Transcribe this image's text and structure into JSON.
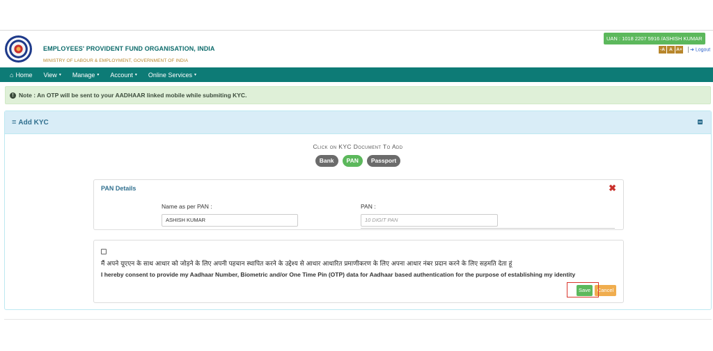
{
  "header": {
    "org_name": "EMPLOYEES' PROVIDENT FUND ORGANISATION, INDIA",
    "ministry": "MINISTRY OF LABOUR & EMPLOYMENT, GOVERNMENT OF INDIA",
    "uan": "UAN : 1018 2207 5916 /ASHISH KUMAR",
    "font_buttons": [
      "-A",
      "A",
      "A+"
    ],
    "logout": "Logout"
  },
  "nav": {
    "items": [
      {
        "label": "Home",
        "icon": "home-icon"
      },
      {
        "label": "View",
        "caret": true
      },
      {
        "label": "Manage",
        "caret": true
      },
      {
        "label": "Account",
        "caret": true
      },
      {
        "label": "Online Services",
        "caret": true
      }
    ]
  },
  "note": {
    "text": "Note : An OTP will be sent to your AADHAAR linked mobile while submiting KYC."
  },
  "panel": {
    "title": "Add KYC",
    "instruction": "Click on KYC Document To Add",
    "doc_buttons": [
      {
        "label": "Bank",
        "active": false
      },
      {
        "label": "PAN",
        "active": true
      },
      {
        "label": "Passport",
        "active": false
      }
    ]
  },
  "pan": {
    "title": "PAN Details",
    "name_label": "Name as per PAN  :",
    "name_value": "ASHISH KUMAR",
    "pan_label": "PAN  :",
    "pan_placeholder": "10 DIGIT PAN"
  },
  "consent": {
    "hindi": "मैं अपने यूएएन के साथ आधार को जोड़ने के लिए अपनी पहचान स्थापित करने के उद्देश्य से आधार आधारित प्रमाणीकरण के लिए अपना आधार नंबर प्रदान करने के लिए सहमति देता हूं",
    "english": "I hereby consent to provide my Aadhaar Number, Biometric and/or One Time Pin (OTP) data for Aadhaar based authentication for the purpose of establishing my identity",
    "save": "Save",
    "cancel": "Cancel"
  },
  "colors": {
    "nav_bg": "#0d7b76",
    "success": "#5cb85c",
    "warning": "#f0ad4e",
    "panel_heading": "#d9edf7",
    "highlight": "#d9342b"
  }
}
